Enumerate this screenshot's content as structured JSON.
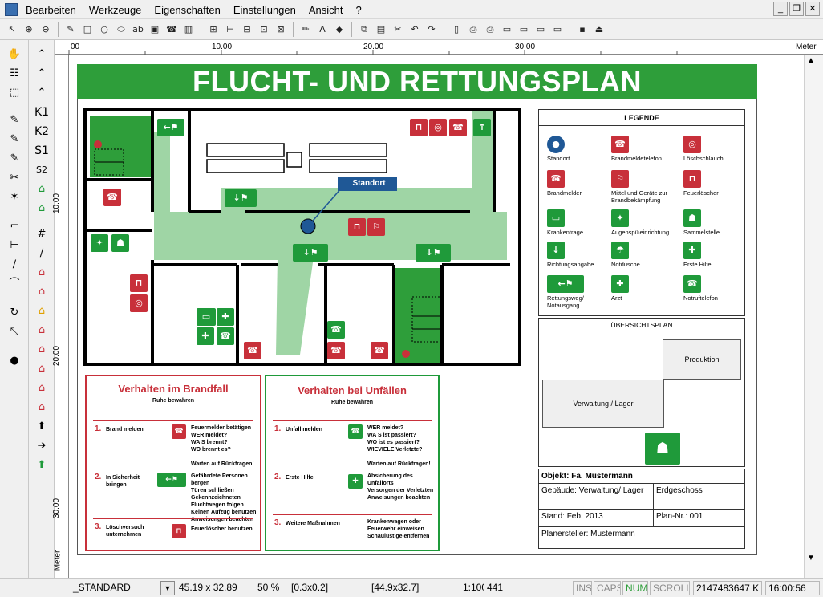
{
  "menubar": {
    "items": [
      "Bearbeiten",
      "Werkzeuge",
      "Eigenschaften",
      "Einstellungen",
      "Ansicht",
      "?"
    ]
  },
  "ruler": {
    "h_labels": [
      "00",
      "10.00",
      "20.00",
      "30.00"
    ],
    "unit": "Meter",
    "v_labels": [
      "10.00",
      "20.00",
      "30.00"
    ],
    "v_unit": "Meter"
  },
  "plan": {
    "title": "FLUCHT- UND RETTUNGSPLAN",
    "standort_label": "Standort"
  },
  "legend": {
    "title": "LEGENDE",
    "items": [
      {
        "icon": "standort",
        "label": "Standort"
      },
      {
        "icon": "phone",
        "label": "Brandmeldetelefon"
      },
      {
        "icon": "hose",
        "label": "Löschschlauch"
      },
      {
        "icon": "alarm",
        "label": "Brandmelder"
      },
      {
        "icon": "equipment",
        "label": "Mittel und Geräte zur Brandbekämpfung"
      },
      {
        "icon": "extinguisher",
        "label": "Feuerlöscher"
      },
      {
        "icon": "stretcher",
        "label": "Krankentrage"
      },
      {
        "icon": "eyewash",
        "label": "Augenspüleinrichtung"
      },
      {
        "icon": "assembly",
        "label": "Sammelstelle"
      },
      {
        "icon": "arrow",
        "label": "Richtungsangabe"
      },
      {
        "icon": "shower",
        "label": "Notdusche"
      },
      {
        "icon": "firstaid",
        "label": "Erste Hilfe"
      },
      {
        "icon": "exit",
        "label": "Rettungsweg/ Notausgang"
      },
      {
        "icon": "doctor",
        "label": "Arzt"
      },
      {
        "icon": "emergencyphone",
        "label": "Notruftelefon"
      }
    ]
  },
  "overview": {
    "title": "ÜBERSICHTSPLAN",
    "production": "Produktion",
    "admin": "Verwaltung / Lager"
  },
  "info": {
    "object": "Objekt: Fa. Mustermann",
    "building": "Gebäude: Verwaltung/ Lager",
    "floor": "Erdgeschoss",
    "date": "Stand: Feb. 2013",
    "planno": "Plan-Nr.: 001",
    "creator": "Planersteller: Mustermann"
  },
  "fire": {
    "title": "Verhalten im Brandfall",
    "subtitle": "Ruhe bewahren",
    "steps": [
      {
        "num": "1.",
        "label": "Brand melden",
        "text": "Feuermelder betätigen\nWER meldet?\nWA S brennt?\nWO brennt es?\n\nWarten auf Rückfragen!"
      },
      {
        "num": "2.",
        "label": "In Sicherheit bringen",
        "text": "Gefährdete Personen bergen\nTüren schließen\nGekennzeichneten Fluchtwegen folgen\nKeinen Aufzug benutzen\nAnweisungen beachten"
      },
      {
        "num": "3.",
        "label": "Löschversuch unternehmen",
        "text": "Feuerlöscher benutzen"
      }
    ]
  },
  "accident": {
    "title": "Verhalten bei Unfällen",
    "subtitle": "Ruhe bewahren",
    "steps": [
      {
        "num": "1.",
        "label": "Unfall melden",
        "text": "WER meldet?\nWA S ist passiert?\nWO ist es passiert?\nWIEVIELE Verletzte?\n\nWarten auf Rückfragen!"
      },
      {
        "num": "2.",
        "label": "Erste Hilfe",
        "text": "Absicherung des Unfallorts\nVersorgen der Verletzten\nAnweisungen beachten"
      },
      {
        "num": "3.",
        "label": "Weitere Maßnahmen",
        "text": "Krankenwagen oder Feuerwehr einweisen\nSchaulustige entfernen"
      }
    ]
  },
  "status": {
    "style": "_STANDARD",
    "dims": "45.19 x 32.89",
    "zoom": "50 %",
    "offset": "[0.3x0.2]",
    "size": "[44.9x32.7]",
    "scale": "1:100",
    "count": "441",
    "ins": "INS",
    "caps": "CAPS",
    "num": "NUM",
    "scroll": "SCROLL",
    "mem": "2147483647 K",
    "time": "16:00:56"
  }
}
